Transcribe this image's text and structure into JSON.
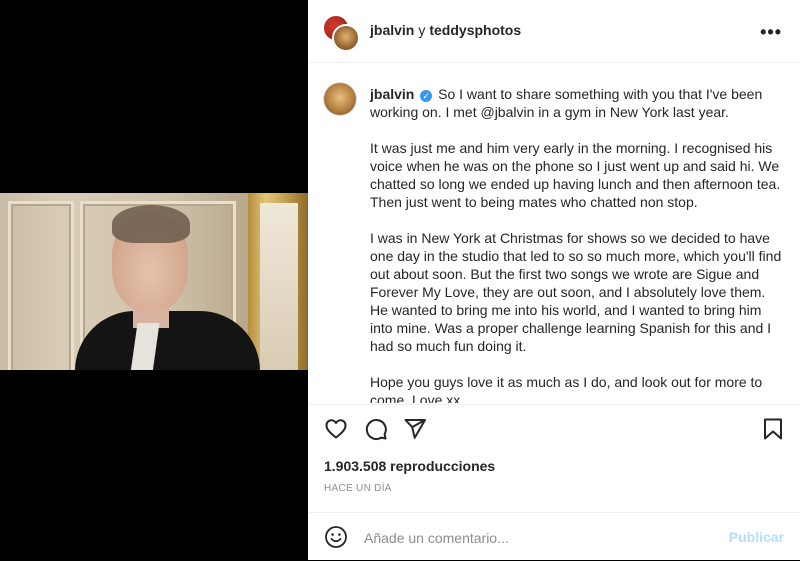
{
  "post": {
    "authors": {
      "primary": "jbalvin",
      "joiner": "y",
      "secondary": "teddysphotos"
    },
    "more_icon": "more-icon"
  },
  "caption": {
    "username": "jbalvin",
    "verified_icon": "verified-badge-icon",
    "paragraphs": [
      "So I want to share something with you that I've been working on. I met @jbalvin in a gym in New York last year.",
      "It was just me and him very early in the morning. I recognised his voice when he was on the phone so I just went up and said hi. We chatted so long we ended up having lunch and then afternoon tea. Then just went to being mates who chatted non stop.",
      "I was in New York at Christmas for shows so we decided to have one day in the studio that led to so so much more, which you'll find out about soon. But the first two songs we wrote are Sigue and Forever My Love, they are out soon, and I absolutely love them. He wanted to bring me into his world, and I wanted to bring him into mine. Was a proper challenge learning Spanish for this and I had so much fun doing it.",
      "Hope you guys love it as much as I do, and look out for more to come. Love xx"
    ]
  },
  "actions": {
    "icons": [
      "heart-icon",
      "comment-icon",
      "share-icon",
      "bookmark-icon"
    ]
  },
  "stats": {
    "views": "1.903.508 reproducciones",
    "timestamp": "HACE UN DÍA"
  },
  "comment": {
    "emoji_icon": "emoji-icon",
    "placeholder": "Añade un comentario...",
    "publish_label": "Publicar"
  },
  "colors": {
    "text": "#262626",
    "muted": "#8e8e8e",
    "verified": "#3897f0",
    "publish_disabled": "#b2dffc"
  }
}
